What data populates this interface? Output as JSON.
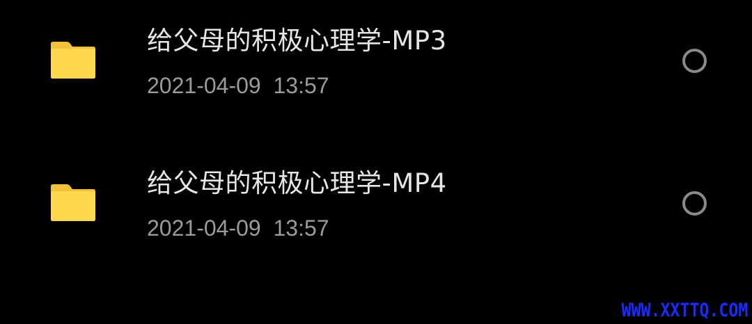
{
  "files": [
    {
      "name": "给父母的积极心理学-MP3",
      "date": "2021-04-09  13:57",
      "icon": "folder-icon",
      "selected": false
    },
    {
      "name": "给父母的积极心理学-MP4",
      "date": "2021-04-09  13:57",
      "icon": "folder-icon",
      "selected": false
    }
  ],
  "colors": {
    "background": "#000000",
    "folder": "#FFD84D",
    "folder_tab": "#F2C23A",
    "title_text": "#E6E6E6",
    "date_text": "#9B9B9B",
    "radio": "#8A8A8A",
    "watermark": "#1A2BFF"
  },
  "watermark": {
    "text": "WWW.XXTTQ.COM"
  }
}
